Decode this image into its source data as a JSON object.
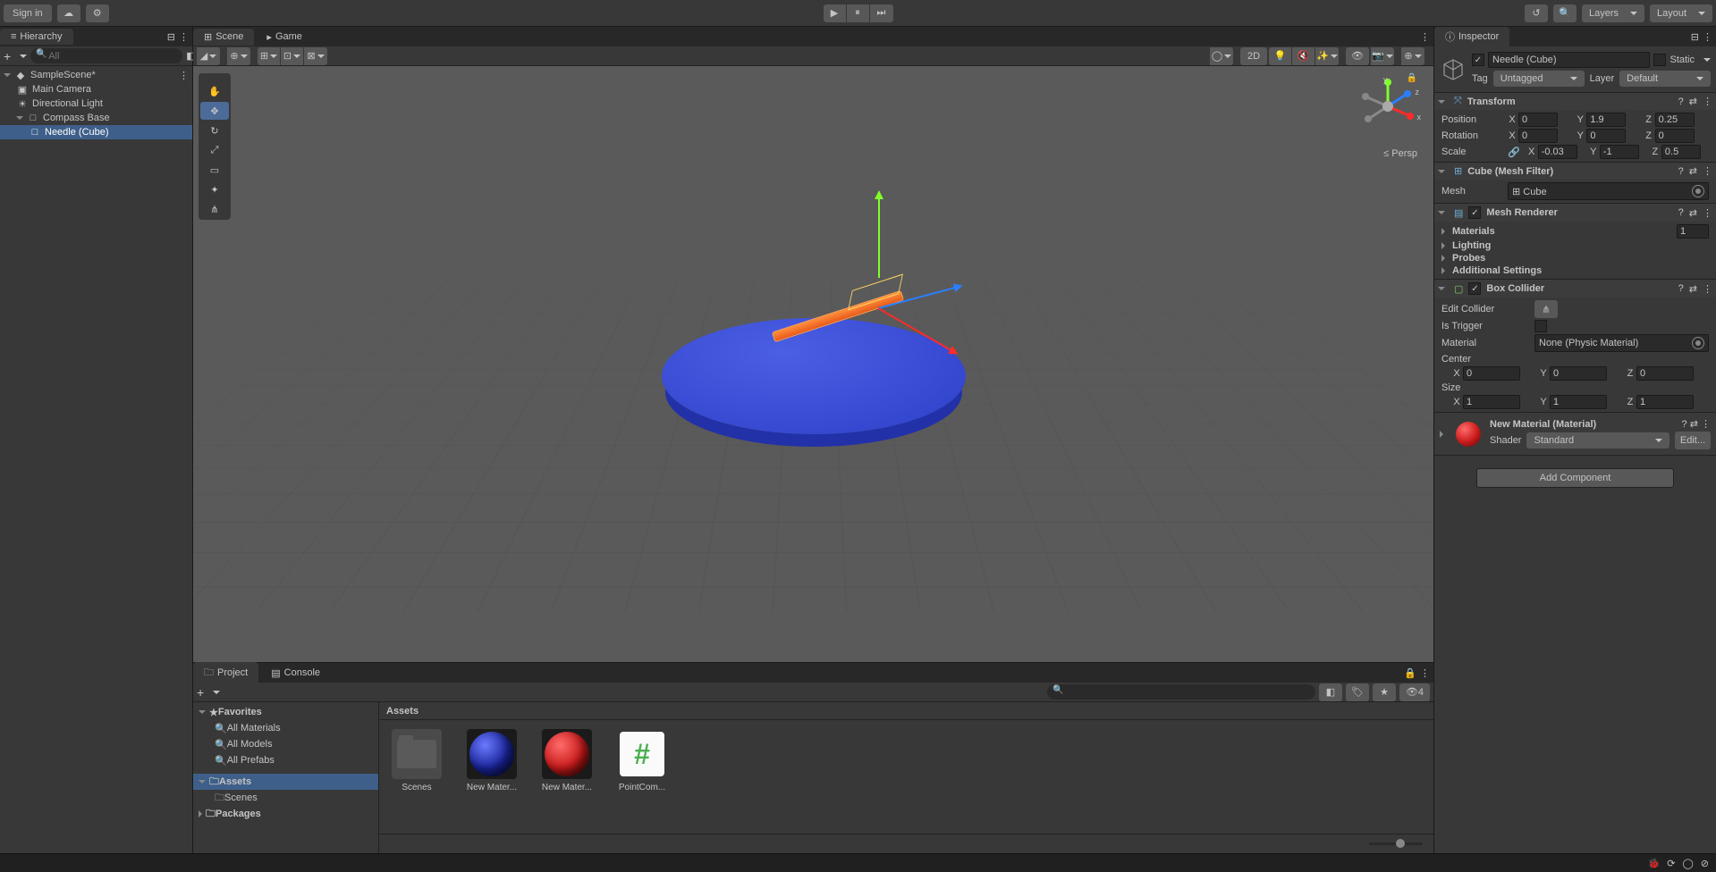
{
  "top_menu": {
    "sign_in": "Sign in"
  },
  "layers_label": "Layers",
  "layout_label": "Layout",
  "tabs": {
    "hierarchy": "Hierarchy",
    "scene": "Scene",
    "game": "Game",
    "inspector": "Inspector",
    "project": "Project",
    "console": "Console"
  },
  "hierarchy": {
    "search_placeholder": "All",
    "scene": "SampleScene*",
    "items": [
      "Main Camera",
      "Directional Light",
      "Compass Base",
      "Needle (Cube)"
    ]
  },
  "scene_view": {
    "persp": "Persp",
    "axis_y": "y",
    "axis_x": "x",
    "axis_z": "z",
    "twoD": "2D"
  },
  "inspector": {
    "name": "Needle (Cube)",
    "static": "Static",
    "tag_label": "Tag",
    "tag_value": "Untagged",
    "layer_label": "Layer",
    "layer_value": "Default",
    "transform": {
      "title": "Transform",
      "position": "Position",
      "rotation": "Rotation",
      "scale": "Scale",
      "pos": {
        "x": "0",
        "y": "1.9",
        "z": "0.25"
      },
      "rot": {
        "x": "0",
        "y": "0",
        "z": "0"
      },
      "scl": {
        "x": "-0.03",
        "y": "-1",
        "z": "0.5"
      }
    },
    "mesh_filter": {
      "title": "Cube (Mesh Filter)",
      "field": "Mesh",
      "value": "Cube"
    },
    "mesh_renderer": {
      "title": "Mesh Renderer",
      "materials": "Materials",
      "materials_count": "1",
      "lighting": "Lighting",
      "probes": "Probes",
      "additional": "Additional Settings"
    },
    "box_collider": {
      "title": "Box Collider",
      "edit": "Edit Collider",
      "trigger": "Is Trigger",
      "material": "Material",
      "material_val": "None (Physic Material)",
      "center": "Center",
      "center_v": {
        "x": "0",
        "y": "0",
        "z": "0"
      },
      "size": "Size",
      "size_v": {
        "x": "1",
        "y": "1",
        "z": "1"
      }
    },
    "material": {
      "name": "New Material (Material)",
      "shader_label": "Shader",
      "shader_value": "Standard",
      "edit": "Edit..."
    },
    "add_component": "Add Component"
  },
  "project": {
    "breadcrumb": "Assets",
    "favorites": "Favorites",
    "fav_items": [
      "All Materials",
      "All Models",
      "All Prefabs"
    ],
    "assets_label": "Assets",
    "scenes_label": "Scenes",
    "packages_label": "Packages",
    "search_placeholder": "",
    "hidden_count": "4",
    "items": [
      {
        "label": "Scenes",
        "type": "folder"
      },
      {
        "label": "New Mater...",
        "type": "mat-blue"
      },
      {
        "label": "New Mater...",
        "type": "mat-red"
      },
      {
        "label": "PointCom...",
        "type": "script"
      }
    ]
  }
}
